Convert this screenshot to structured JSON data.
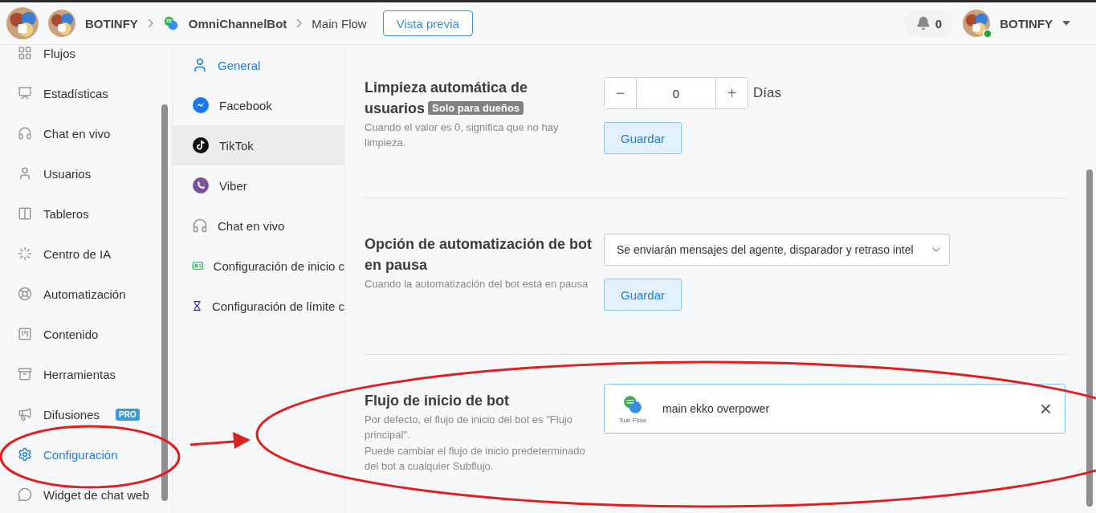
{
  "topbar": {
    "workspace": "BOTINFY",
    "breadcrumbs": [
      {
        "label": "OmniChannelBot",
        "kind": "bot"
      },
      {
        "label": "Main Flow",
        "kind": "plain"
      }
    ],
    "preview_button": "Vista previa",
    "notifications": "0",
    "user": {
      "name": "BOTINFY",
      "online": true
    }
  },
  "sidebar": {
    "items": [
      {
        "label": "Flujos",
        "selected": false
      },
      {
        "label": "Estadísticas",
        "selected": false
      },
      {
        "label": "Chat en vivo",
        "selected": false
      },
      {
        "label": "Usuarios",
        "selected": false
      },
      {
        "label": "Tableros",
        "selected": false
      },
      {
        "label": "Centro de IA",
        "selected": false
      },
      {
        "label": "Automatización",
        "selected": false
      },
      {
        "label": "Contenido",
        "selected": false
      },
      {
        "label": "Herramientas",
        "selected": false
      },
      {
        "label": "Difusiones",
        "selected": false,
        "badge": "PRO"
      },
      {
        "label": "Configuración",
        "selected": true
      },
      {
        "label": "Widget de chat web",
        "selected": false
      }
    ]
  },
  "settings_nav": {
    "items": [
      {
        "label": "General",
        "selected": true,
        "hovered": false
      },
      {
        "label": "Facebook",
        "selected": false,
        "hovered": false
      },
      {
        "label": "TikTok",
        "selected": false,
        "hovered": true
      },
      {
        "label": "Viber",
        "selected": false,
        "hovered": false
      },
      {
        "label": "Chat en vivo",
        "selected": false,
        "hovered": false
      },
      {
        "label": "Configuración de inicio c",
        "selected": false,
        "hovered": false
      },
      {
        "label": "Configuración de límite c",
        "selected": false,
        "hovered": false
      }
    ]
  },
  "sections": [
    {
      "kind": "stepper",
      "title": "Limpieza automática de usuarios",
      "badge": "Solo para dueños",
      "description": [
        "Cuando el valor es 0, significa que no hay limpieza."
      ],
      "decrement": "−",
      "value": "0",
      "increment": "+",
      "unit": "Días",
      "button": "Guardar"
    },
    {
      "kind": "select",
      "title": "Opción de automatización de bot en pausa",
      "description": [
        "Cuando la automatización del bot está en pausa"
      ],
      "value": "Se enviarán mensajes del agente, disparador y retraso intel",
      "button": "Guardar"
    },
    {
      "kind": "flow",
      "title": "Flujo de inicio de bot",
      "description": [
        "Por defecto, el flujo de inicio del bot es \"Flujo principal\".",
        "Puede cambiar el flujo de inicio predeterminado del bot a cualquier Subflujo."
      ],
      "flow_type": "Sub Flow",
      "flow_name": "main ekko overpower",
      "clear": "×"
    }
  ]
}
